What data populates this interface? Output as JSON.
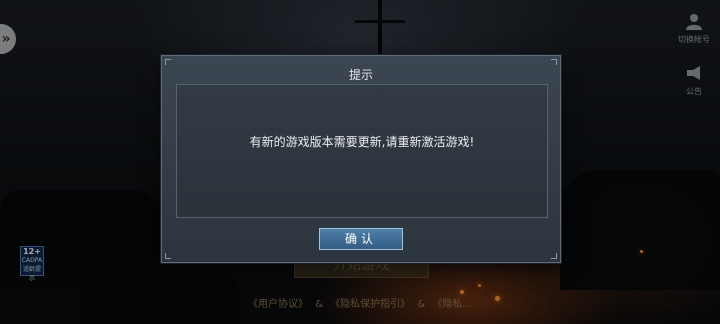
{
  "top_right": {
    "switch_account_label": "切换帐号",
    "announcement_label": "公告"
  },
  "age_badge": {
    "age": "12+",
    "text": "CADPA",
    "note": "适龄提示"
  },
  "start_button_label": "开始游戏",
  "agreements": {
    "user_agreement": "《用户协议》",
    "sep1": "&",
    "privacy_guide": "《隐私保护指引》",
    "sep2": "&",
    "third": "《隐私..."
  },
  "dialog": {
    "title": "提示",
    "message": "有新的游戏版本需要更新,请重新激活游戏!",
    "confirm_label": "确认"
  },
  "colors": {
    "confirm_button": "#3f6d96",
    "dialog_bg": "#333c46"
  }
}
